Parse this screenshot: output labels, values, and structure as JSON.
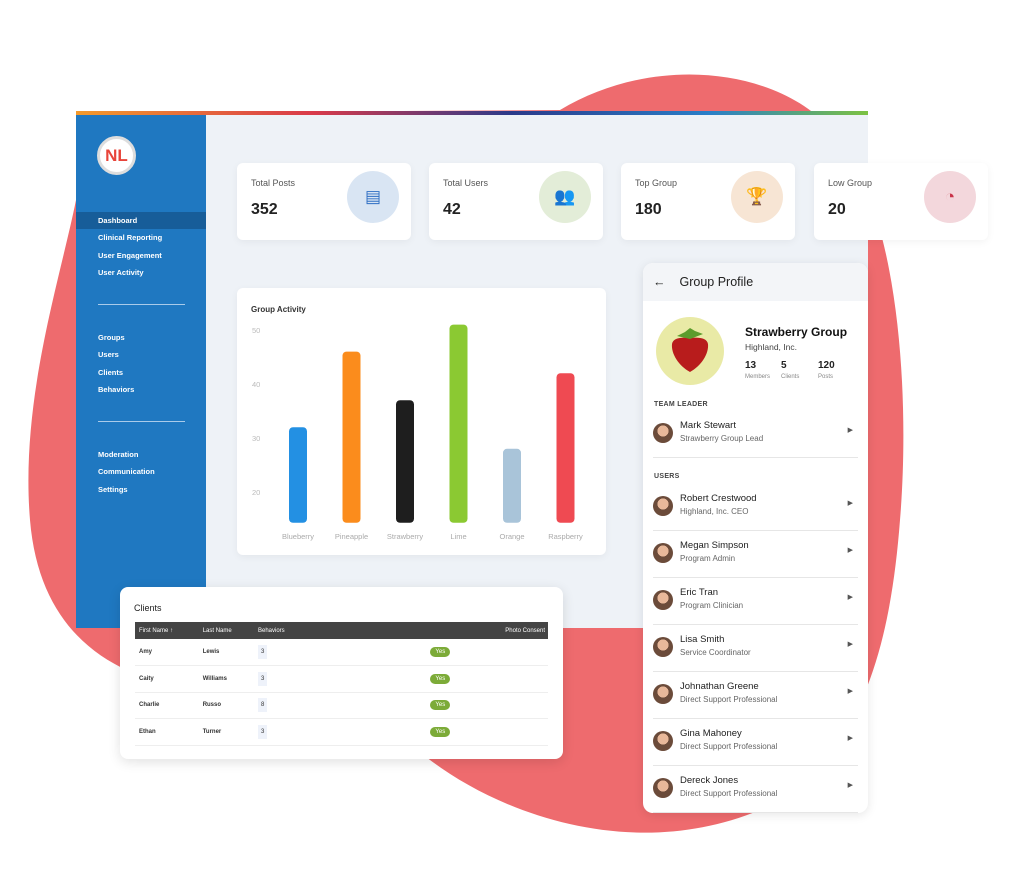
{
  "sidebar": {
    "logo": "NL",
    "items_top": [
      "Dashboard",
      "Clinical Reporting",
      "User Engagement",
      "User Activity"
    ],
    "items_mid": [
      "Groups",
      "Users",
      "Clients",
      "Behaviors"
    ],
    "items_bottom": [
      "Moderation",
      "Communication",
      "Settings"
    ],
    "active": "Dashboard",
    "color": "#1f78c1"
  },
  "stats": [
    {
      "label": "Total Posts",
      "value": "352",
      "icon": "document-icon",
      "bg": "#d9e5f3",
      "fg": "#2f6fc4"
    },
    {
      "label": "Total Users",
      "value": "42",
      "icon": "users-icon",
      "bg": "#e3edd8",
      "fg": "#6fa83a"
    },
    {
      "label": "Top Group",
      "value": "180",
      "icon": "trophy-icon",
      "bg": "#f7e5d4",
      "fg": "#d6852f"
    },
    {
      "label": "Low Group",
      "value": "20",
      "icon": "gauge-icon",
      "bg": "#f3d7dc",
      "fg": "#c9344a"
    }
  ],
  "chart_data": {
    "type": "bar",
    "title": "Group Activity",
    "categories": [
      "Blueberry",
      "Pineapple",
      "Strawberry",
      "Lime",
      "Orange",
      "Raspberry"
    ],
    "values": [
      32,
      46,
      37,
      51,
      28,
      42
    ],
    "colors": [
      "#2390e3",
      "#fb8c1c",
      "#1e1e1e",
      "#8bc932",
      "#a9c4d9",
      "#ef4a52"
    ],
    "yticks": [
      20,
      30,
      40,
      50
    ],
    "ylim": [
      14.3,
      52
    ],
    "grid": false
  },
  "clients": {
    "title": "Clients",
    "columns": [
      "First Name ↑",
      "Last Name",
      "Behaviors",
      "Photo Consent"
    ],
    "rows": [
      [
        "Amy",
        "Lewis",
        "3",
        "Yes"
      ],
      [
        "Caity",
        "Williams",
        "3",
        "Yes"
      ],
      [
        "Charlie",
        "Russo",
        "8",
        "Yes"
      ],
      [
        "Ethan",
        "Turner",
        "3",
        "Yes"
      ]
    ]
  },
  "profile": {
    "title": "Group Profile",
    "name": "Strawberry Group",
    "org": "Highland, Inc.",
    "stats": [
      {
        "v": "13",
        "l": "Members"
      },
      {
        "v": "5",
        "l": "Clients"
      },
      {
        "v": "120",
        "l": "Posts"
      }
    ],
    "leader_label": "TEAM LEADER",
    "leader": {
      "name": "Mark Stewart",
      "role": "Strawberry Group Lead"
    },
    "users_label": "USERS",
    "users": [
      {
        "name": "Robert Crestwood",
        "role": "Highland, Inc. CEO"
      },
      {
        "name": "Megan Simpson",
        "role": "Program Admin"
      },
      {
        "name": "Eric Tran",
        "role": "Program Clinician"
      },
      {
        "name": "Lisa Smith",
        "role": "Service Coordinator"
      },
      {
        "name": "Johnathan Greene",
        "role": "Direct Support Professional"
      },
      {
        "name": "Gina Mahoney",
        "role": "Direct Support Professional"
      },
      {
        "name": "Dereck Jones",
        "role": "Direct Support Professional"
      }
    ]
  }
}
